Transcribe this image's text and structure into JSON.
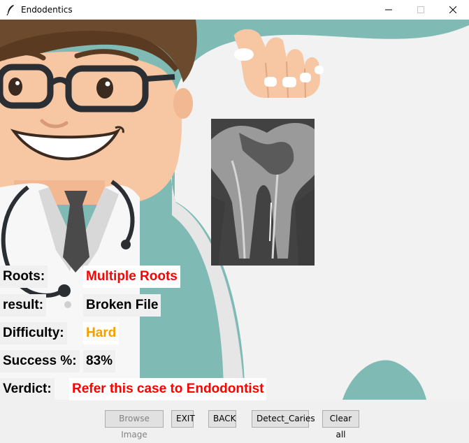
{
  "window": {
    "title": "Endodentics",
    "controls": [
      "minimize",
      "maximize",
      "close"
    ]
  },
  "results": {
    "roots_label": "Roots:",
    "roots_value": "Multiple Roots",
    "result_label": "result:",
    "result_value": "Broken File",
    "difficulty_label": "Difficulty:",
    "difficulty_value": "Hard",
    "success_label": "Success %:",
    "success_value": "83%",
    "verdict_label": "Verdict:",
    "verdict_value": "Refer this case to Endodontist"
  },
  "colors": {
    "roots_value": "#ff0000",
    "difficulty_value": "#f5a000",
    "verdict_value": "#ff0000",
    "background_teal": "#7fbbb4"
  },
  "buttons": {
    "browse": "Browse Image",
    "exit": "EXIT",
    "back": "BACK",
    "detect": "Detect_Caries",
    "clear": "Clear all"
  }
}
